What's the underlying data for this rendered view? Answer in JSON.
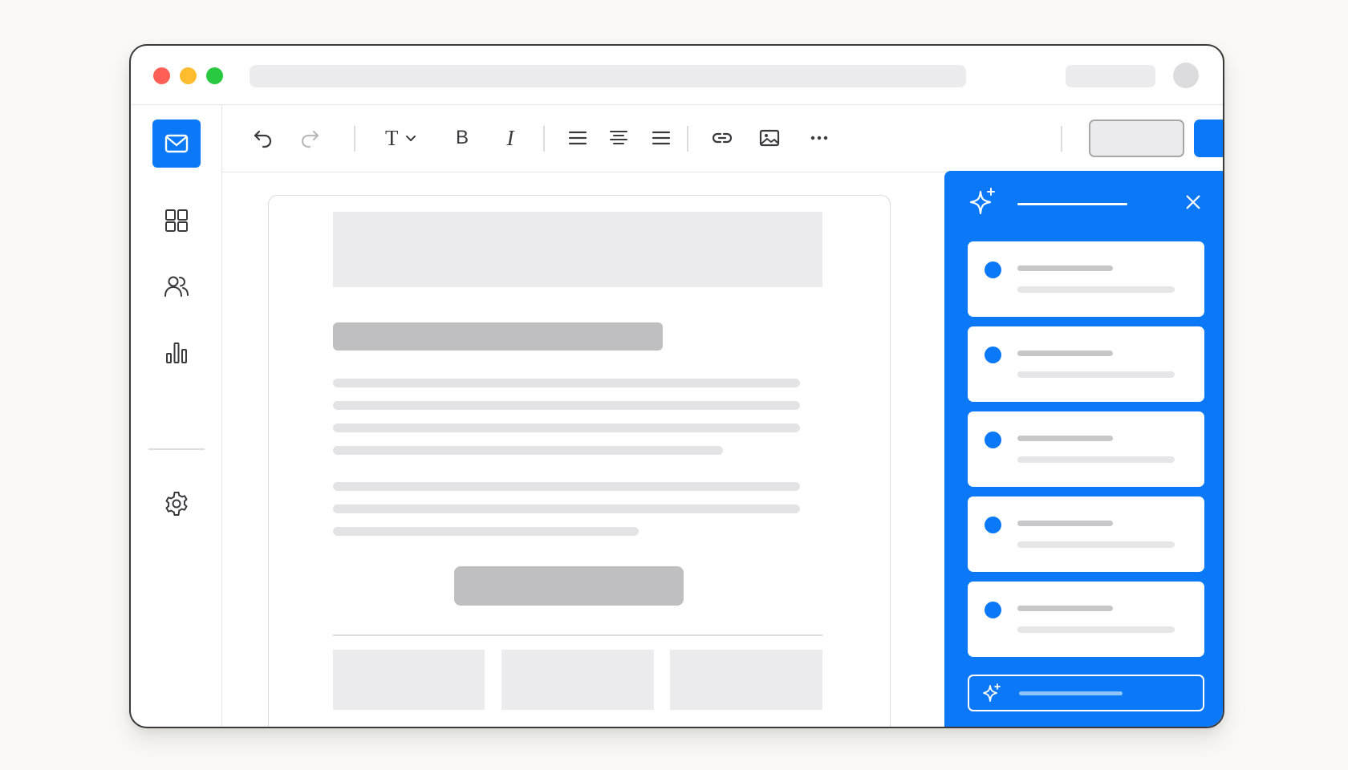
{
  "app": {
    "window_controls": [
      "close",
      "minimize",
      "maximize"
    ],
    "colors": {
      "close": "#ff5f57",
      "minimize": "#febc2e",
      "maximize": "#28c840",
      "accent": "#0a78f7",
      "placeholder": "#ececee"
    }
  },
  "sidebar": {
    "items": [
      {
        "name": "mail",
        "icon": "mail-icon",
        "active": true
      },
      {
        "name": "templates",
        "icon": "grid-icon",
        "active": false
      },
      {
        "name": "contacts",
        "icon": "users-icon",
        "active": false
      },
      {
        "name": "analytics",
        "icon": "bar-chart-icon",
        "active": false
      },
      {
        "name": "settings",
        "icon": "gear-icon",
        "active": false
      }
    ]
  },
  "toolbar": {
    "tools": [
      "undo-icon",
      "redo-icon",
      "text-style-icon",
      "bold-icon",
      "italic-icon",
      "align-left-icon",
      "align-center-icon",
      "align-right-icon",
      "link-icon",
      "image-icon",
      "more-icon"
    ],
    "text_style_glyph": "T",
    "bold_glyph": "B",
    "italic_glyph": "I"
  },
  "ai_panel": {
    "header_icon": "sparkle-icon",
    "close_icon": "close-icon",
    "suggestion_count": 5,
    "input_icon": "sparkle-icon"
  }
}
